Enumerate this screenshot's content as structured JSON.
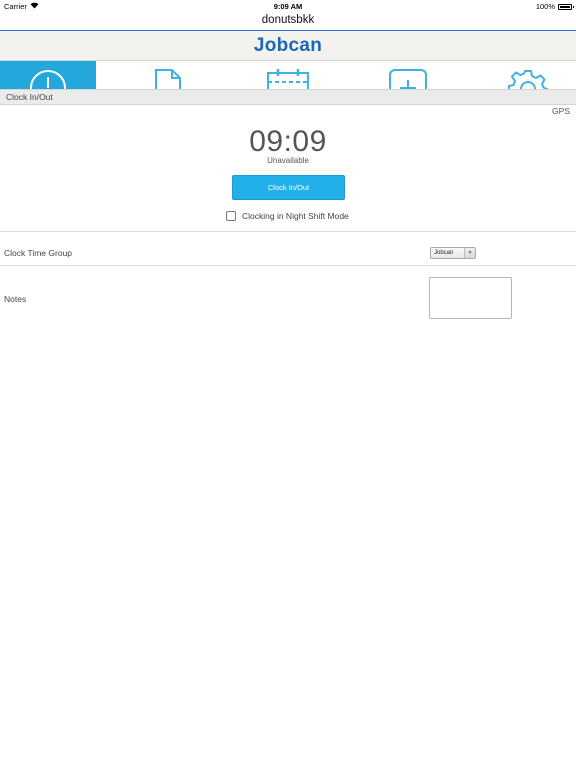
{
  "status_bar": {
    "carrier": "Carrier",
    "time": "9:09 AM",
    "battery_text": "100%",
    "battery_level": 1.0
  },
  "nav": {
    "title": "donutsbkk"
  },
  "logo": {
    "text": "Jobcan",
    "brand_color": "#1c66b4"
  },
  "tabs": [
    {
      "icon": "clock-icon",
      "active": true
    },
    {
      "icon": "document-icon",
      "active": false
    },
    {
      "icon": "calendar-icon",
      "active": false
    },
    {
      "icon": "add-icon",
      "active": false
    },
    {
      "icon": "gear-icon",
      "active": false
    }
  ],
  "colors": {
    "accent": "#24a8dc",
    "button": "#22b0eb",
    "icon": "#3eb2e2"
  },
  "section": {
    "title": "Clock In/Out"
  },
  "gps": {
    "label": "GPS"
  },
  "clock": {
    "time": "09:09",
    "status": "Unavailable",
    "button_label": "Clock In/Out"
  },
  "night_shift": {
    "label": "Clocking in Night Shift Mode",
    "checked": false
  },
  "time_group": {
    "label": "Clock Time Group",
    "selected": "Jobcan"
  },
  "notes": {
    "label": "Notes",
    "value": ""
  }
}
